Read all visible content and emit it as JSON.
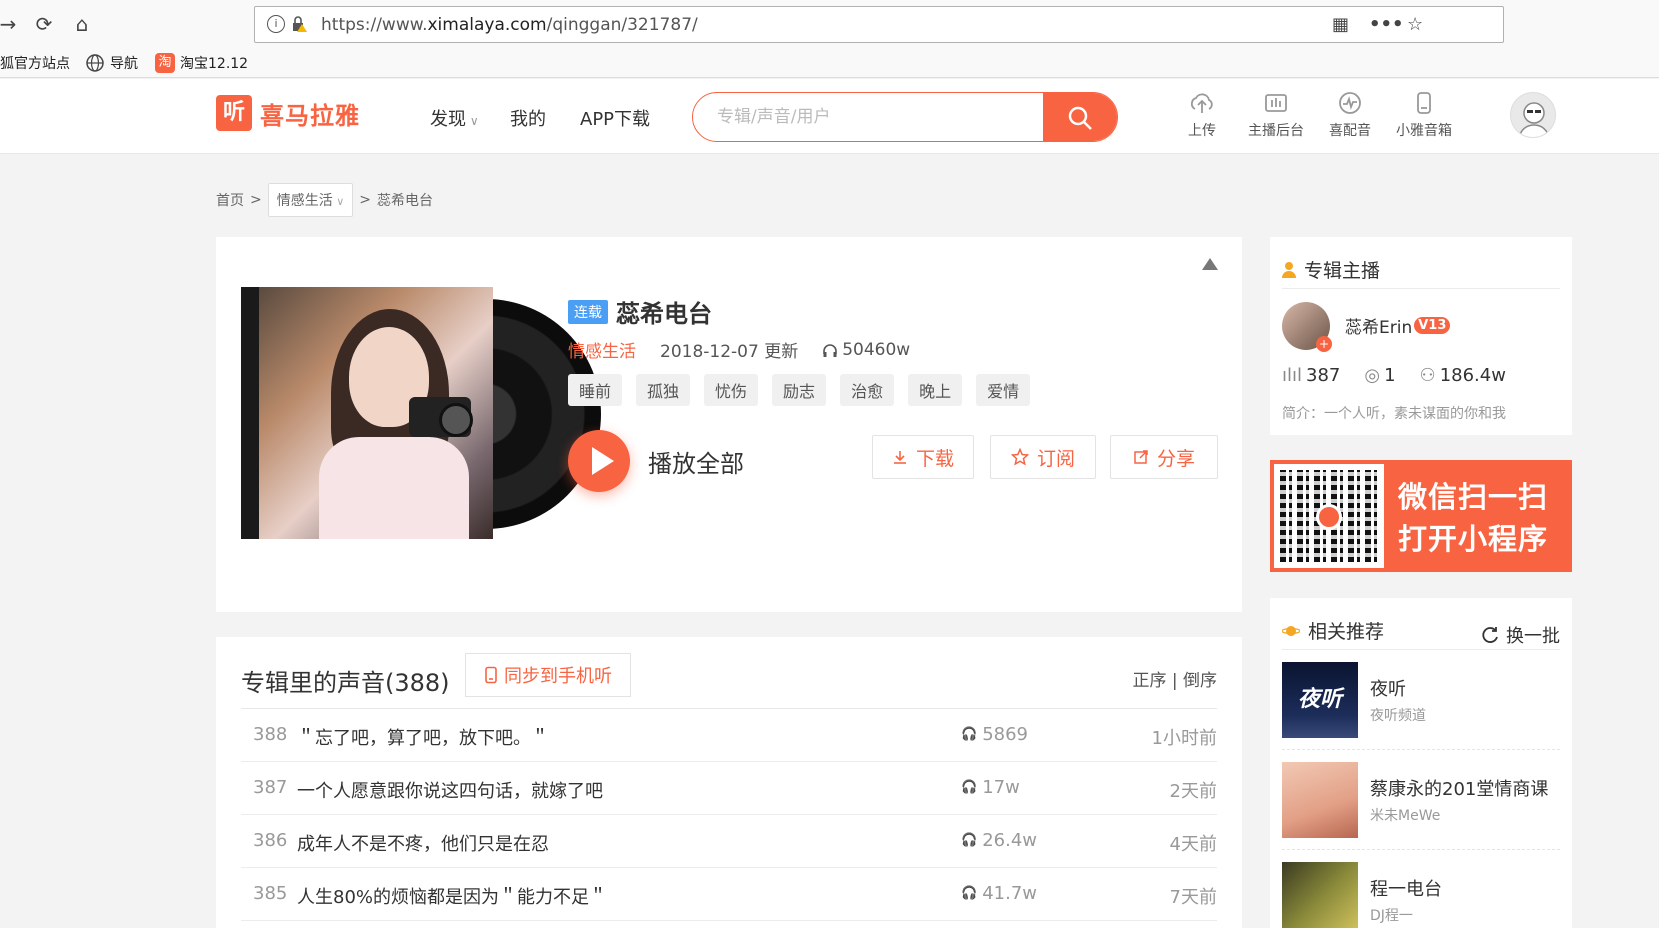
{
  "browser": {
    "url_prefix": "https://www.",
    "url_domain": "ximalaya.com",
    "url_path": "/qinggan/321787/",
    "bookmarks": [
      {
        "label": "狐官方站点"
      },
      {
        "label": "导航"
      },
      {
        "label": "淘宝12.12"
      }
    ]
  },
  "header": {
    "logo_icon": "听",
    "logo_text": "喜马拉雅",
    "nav": [
      {
        "label": "发现"
      },
      {
        "label": "我的"
      },
      {
        "label": "APP下载"
      }
    ],
    "search_placeholder": "专辑/声音/用户",
    "tools": [
      {
        "label": "上传",
        "icon": "upload-icon"
      },
      {
        "label": "主播后台",
        "icon": "studio-icon"
      },
      {
        "label": "喜配音",
        "icon": "dubbing-icon"
      },
      {
        "label": "小雅音箱",
        "icon": "speaker-icon"
      }
    ]
  },
  "breadcrumb": {
    "home": "首页",
    "category": "情感生活",
    "current": "蕊希电台",
    "separator": ">"
  },
  "album": {
    "badge": "连载",
    "title": "蕊希电台",
    "category": "情感生活",
    "updated": "2018-12-07 更新",
    "plays": "50460w",
    "tags": [
      "睡前",
      "孤独",
      "忧伤",
      "励志",
      "治愈",
      "晚上",
      "爱情"
    ],
    "play_all": "播放全部",
    "actions": {
      "download": "下载",
      "subscribe": "订阅",
      "share": "分享"
    }
  },
  "tracks": {
    "title": "专辑里的声音(388)",
    "sync": "同步到手机听",
    "sort_asc": "正序",
    "sort_sep": "|",
    "sort_desc": "倒序",
    "items": [
      {
        "num": "388",
        "title": "＂忘了吧，算了吧，放下吧。＂",
        "plays": "5869",
        "time": "1小时前"
      },
      {
        "num": "387",
        "title": "一个人愿意跟你说这四句话，就嫁了吧",
        "plays": "17w",
        "time": "2天前"
      },
      {
        "num": "386",
        "title": "成年人不是不疼，他们只是在忍",
        "plays": "26.4w",
        "time": "4天前"
      },
      {
        "num": "385",
        "title": "人生80%的烦恼都是因为＂能力不足＂",
        "plays": "41.7w",
        "time": "7天前"
      }
    ]
  },
  "anchor": {
    "section_title": "专辑主播",
    "name": "蕊希Erin",
    "level": "V13",
    "tracks": "387",
    "albums": "1",
    "fans": "186.4w",
    "intro": "简介：一个人听，素未谋面的你和我"
  },
  "qr_banner": {
    "line1": "微信扫一扫",
    "line2": "打开小程序"
  },
  "recommend": {
    "title": "相关推荐",
    "refresh": "换一批",
    "items": [
      {
        "title": "夜听",
        "sub": "夜听频道",
        "thumb_text": "夜听"
      },
      {
        "title": "蔡康永的201堂情商课",
        "sub": "米未MeWe"
      },
      {
        "title": "程一电台",
        "sub": "DJ程一"
      }
    ]
  },
  "colors": {
    "brand": "#f86442",
    "serial_badge": "#4a9ff5"
  }
}
